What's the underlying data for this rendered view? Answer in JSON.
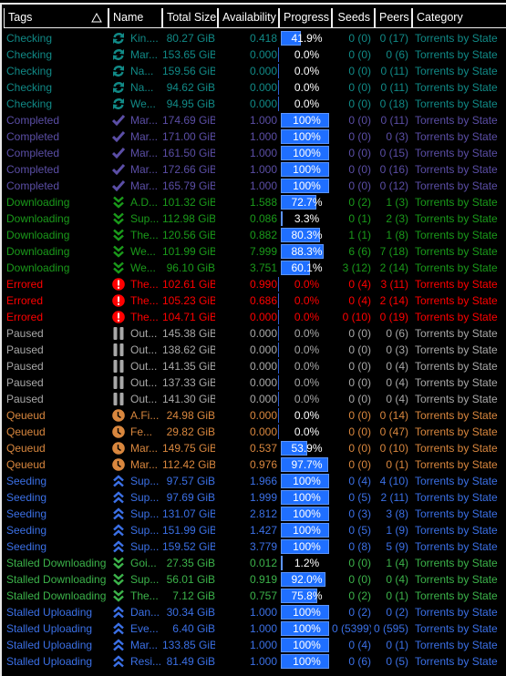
{
  "columns": {
    "tags": "Tags",
    "name": "Name",
    "size": "Total Size",
    "availability": "Availability",
    "progress": "Progress",
    "seeds": "Seeds",
    "peers": "Peers",
    "category": "Category"
  },
  "sort_indicator": "ascending",
  "state_colors": {
    "Checking": "#118a87",
    "Completed": "#5b4ea6",
    "Downloading": "#1a9a1a",
    "Errored": "#ff0000",
    "Paused": "#a8a8a8",
    "Qeueud": "#d9873e",
    "Seeding": "#3b70e6",
    "Stalled Downloading": "#3cb34a",
    "Stalled Uploading": "#3b70e6"
  },
  "state_icons": {
    "Checking": "refresh-icon",
    "Completed": "checkmark-icon",
    "Downloading": "double-chevron-down-icon",
    "Errored": "error-icon",
    "Paused": "pause-icon",
    "Qeueud": "clock-icon",
    "Seeding": "double-chevron-up-icon",
    "Stalled Downloading": "double-chevron-down-icon",
    "Stalled Uploading": "double-chevron-up-icon"
  },
  "rows": [
    {
      "tag": "Checking",
      "name": "Kin....",
      "size": "80.27 GiB",
      "availability": "0.418",
      "progress": "41.9%",
      "seeds": "0 (0)",
      "peers": "0 (17)",
      "category": "Torrents by State"
    },
    {
      "tag": "Checking",
      "name": "Mar...",
      "size": "153.65 GiB",
      "availability": "0.000",
      "progress": "0.0%",
      "seeds": "0 (0)",
      "peers": "0 (6)",
      "category": "Torrents by State"
    },
    {
      "tag": "Checking",
      "name": "Na...",
      "size": "159.56 GiB",
      "availability": "0.000",
      "progress": "0.0%",
      "seeds": "0 (0)",
      "peers": "0 (11)",
      "category": "Torrents by State"
    },
    {
      "tag": "Checking",
      "name": "Na...",
      "size": "94.62 GiB",
      "availability": "0.000",
      "progress": "0.0%",
      "seeds": "0 (0)",
      "peers": "0 (11)",
      "category": "Torrents by State"
    },
    {
      "tag": "Checking",
      "name": "We...",
      "size": "94.95 GiB",
      "availability": "0.000",
      "progress": "0.0%",
      "seeds": "0 (0)",
      "peers": "0 (18)",
      "category": "Torrents by State"
    },
    {
      "tag": "Completed",
      "name": "Mar...",
      "size": "174.69 GiB",
      "availability": "1.000",
      "progress": "100%",
      "seeds": "0 (0)",
      "peers": "0 (11)",
      "category": "Torrents by State"
    },
    {
      "tag": "Completed",
      "name": "Mar...",
      "size": "171.00 GiB",
      "availability": "1.000",
      "progress": "100%",
      "seeds": "0 (0)",
      "peers": "0 (3)",
      "category": "Torrents by State"
    },
    {
      "tag": "Completed",
      "name": "Mar...",
      "size": "161.50 GiB",
      "availability": "1.000",
      "progress": "100%",
      "seeds": "0 (0)",
      "peers": "0 (15)",
      "category": "Torrents by State"
    },
    {
      "tag": "Completed",
      "name": "Mar...",
      "size": "172.66 GiB",
      "availability": "1.000",
      "progress": "100%",
      "seeds": "0 (0)",
      "peers": "0 (16)",
      "category": "Torrents by State"
    },
    {
      "tag": "Completed",
      "name": "Mar...",
      "size": "165.79 GiB",
      "availability": "1.000",
      "progress": "100%",
      "seeds": "0 (0)",
      "peers": "0 (12)",
      "category": "Torrents by State"
    },
    {
      "tag": "Downloading",
      "name": "A.D...",
      "size": "101.32 GiB",
      "availability": "1.588",
      "progress": "72.7%",
      "seeds": "0 (2)",
      "peers": "1 (3)",
      "category": "Torrents by State"
    },
    {
      "tag": "Downloading",
      "name": "Sup...",
      "size": "112.98 GiB",
      "availability": "0.086",
      "progress": "3.3%",
      "seeds": "0 (1)",
      "peers": "2 (3)",
      "category": "Torrents by State"
    },
    {
      "tag": "Downloading",
      "name": "The...",
      "size": "120.56 GiB",
      "availability": "0.882",
      "progress": "80.3%",
      "seeds": "1 (1)",
      "peers": "1 (8)",
      "category": "Torrents by State"
    },
    {
      "tag": "Downloading",
      "name": "We...",
      "size": "101.99 GiB",
      "availability": "7.999",
      "progress": "88.3%",
      "seeds": "6 (6)",
      "peers": "7 (18)",
      "category": "Torrents by State"
    },
    {
      "tag": "Downloading",
      "name": "We...",
      "size": "96.10 GiB",
      "availability": "3.751",
      "progress": "60.1%",
      "seeds": "3 (12)",
      "peers": "2 (14)",
      "category": "Torrents by State"
    },
    {
      "tag": "Errored",
      "name": "The...",
      "size": "102.61 GiB",
      "availability": "0.990",
      "progress": "0.0%",
      "seeds": "0 (4)",
      "peers": "3 (11)",
      "category": "Torrents by State"
    },
    {
      "tag": "Errored",
      "name": "The...",
      "size": "105.23 GiB",
      "availability": "0.686",
      "progress": "0.0%",
      "seeds": "0 (4)",
      "peers": "2 (14)",
      "category": "Torrents by State"
    },
    {
      "tag": "Errored",
      "name": "The...",
      "size": "104.71 GiB",
      "availability": "0.000",
      "progress": "0.0%",
      "seeds": "0 (10)",
      "peers": "0 (19)",
      "category": "Torrents by State"
    },
    {
      "tag": "Paused",
      "name": "Out...",
      "size": "145.38 GiB",
      "availability": "0.000",
      "progress": "0.0%",
      "seeds": "0 (0)",
      "peers": "0 (6)",
      "category": "Torrents by State"
    },
    {
      "tag": "Paused",
      "name": "Out...",
      "size": "138.62 GiB",
      "availability": "0.000",
      "progress": "0.0%",
      "seeds": "0 (0)",
      "peers": "0 (3)",
      "category": "Torrents by State"
    },
    {
      "tag": "Paused",
      "name": "Out...",
      "size": "141.35 GiB",
      "availability": "0.000",
      "progress": "0.0%",
      "seeds": "0 (0)",
      "peers": "0 (4)",
      "category": "Torrents by State"
    },
    {
      "tag": "Paused",
      "name": "Out...",
      "size": "137.33 GiB",
      "availability": "0.000",
      "progress": "0.0%",
      "seeds": "0 (0)",
      "peers": "0 (4)",
      "category": "Torrents by State"
    },
    {
      "tag": "Paused",
      "name": "Out...",
      "size": "141.30 GiB",
      "availability": "0.000",
      "progress": "0.0%",
      "seeds": "0 (0)",
      "peers": "0 (4)",
      "category": "Torrents by State"
    },
    {
      "tag": "Qeueud",
      "name": "A.Fi...",
      "size": "24.98 GiB",
      "availability": "0.000",
      "progress": "0.0%",
      "seeds": "0 (0)",
      "peers": "0 (14)",
      "category": "Torrents by State"
    },
    {
      "tag": "Qeueud",
      "name": "Fe...",
      "size": "29.82 GiB",
      "availability": "0.000",
      "progress": "0.0%",
      "seeds": "0 (0)",
      "peers": "0 (47)",
      "category": "Torrents by State"
    },
    {
      "tag": "Qeueud",
      "name": "Mar...",
      "size": "149.75 GiB",
      "availability": "0.537",
      "progress": "53.9%",
      "seeds": "0 (0)",
      "peers": "0 (10)",
      "category": "Torrents by State"
    },
    {
      "tag": "Qeueud",
      "name": "Mar...",
      "size": "112.42 GiB",
      "availability": "0.976",
      "progress": "97.7%",
      "seeds": "0 (0)",
      "peers": "0 (1)",
      "category": "Torrents by State"
    },
    {
      "tag": "Seeding",
      "name": "Sup...",
      "size": "97.57 GiB",
      "availability": "1.966",
      "progress": "100%",
      "seeds": "0 (4)",
      "peers": "4 (10)",
      "category": "Torrents by State"
    },
    {
      "tag": "Seeding",
      "name": "Sup...",
      "size": "97.69 GiB",
      "availability": "1.999",
      "progress": "100%",
      "seeds": "0 (5)",
      "peers": "2 (11)",
      "category": "Torrents by State"
    },
    {
      "tag": "Seeding",
      "name": "Sup...",
      "size": "131.07 GiB",
      "availability": "2.812",
      "progress": "100%",
      "seeds": "0 (3)",
      "peers": "3 (8)",
      "category": "Torrents by State"
    },
    {
      "tag": "Seeding",
      "name": "Sup...",
      "size": "151.99 GiB",
      "availability": "1.427",
      "progress": "100%",
      "seeds": "0 (5)",
      "peers": "1 (9)",
      "category": "Torrents by State"
    },
    {
      "tag": "Seeding",
      "name": "Sup...",
      "size": "159.52 GiB",
      "availability": "3.779",
      "progress": "100%",
      "seeds": "0 (8)",
      "peers": "5 (9)",
      "category": "Torrents by State"
    },
    {
      "tag": "Stalled Downloading",
      "name": "Goi...",
      "size": "27.35 GiB",
      "availability": "0.012",
      "progress": "1.2%",
      "seeds": "0 (0)",
      "peers": "1 (4)",
      "category": "Torrents by State"
    },
    {
      "tag": "Stalled Downloading",
      "name": "Sup...",
      "size": "56.01 GiB",
      "availability": "0.919",
      "progress": "92.0%",
      "seeds": "0 (0)",
      "peers": "0 (4)",
      "category": "Torrents by State"
    },
    {
      "tag": "Stalled Downloading",
      "name": "The...",
      "size": "7.12 GiB",
      "availability": "0.757",
      "progress": "75.8%",
      "seeds": "0 (2)",
      "peers": "0 (1)",
      "category": "Torrents by State"
    },
    {
      "tag": "Stalled Uploading",
      "name": "Dan...",
      "size": "30.34 GiB",
      "availability": "1.000",
      "progress": "100%",
      "seeds": "0 (2)",
      "peers": "0 (2)",
      "category": "Torrents by State"
    },
    {
      "tag": "Stalled Uploading",
      "name": "Eve...",
      "size": "6.40 GiB",
      "availability": "1.000",
      "progress": "100%",
      "seeds": "0 (5399)",
      "peers": "0 (595)",
      "category": "Torrents by State"
    },
    {
      "tag": "Stalled Uploading",
      "name": "Mar...",
      "size": "133.85 GiB",
      "availability": "1.000",
      "progress": "100%",
      "seeds": "0 (4)",
      "peers": "0 (1)",
      "category": "Torrents by State"
    },
    {
      "tag": "Stalled Uploading",
      "name": "Resi...",
      "size": "81.49 GiB",
      "availability": "1.000",
      "progress": "100%",
      "seeds": "0 (6)",
      "peers": "0 (5)",
      "category": "Torrents by State"
    }
  ]
}
